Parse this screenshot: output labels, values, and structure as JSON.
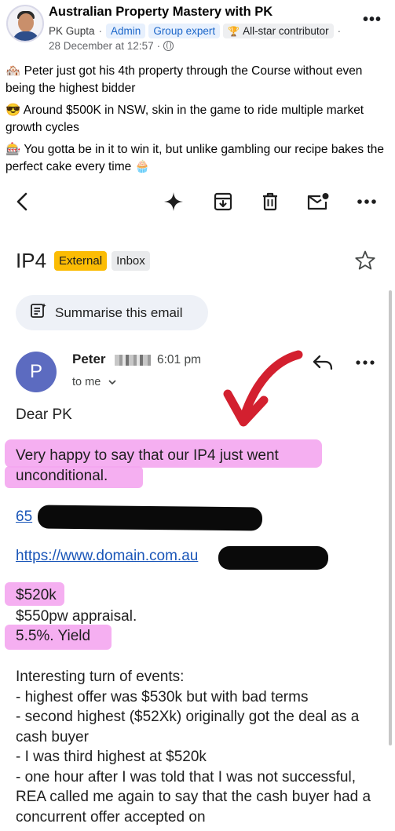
{
  "post": {
    "group_name": "Australian Property Mastery with PK",
    "author": "PK Gupta",
    "badges": [
      "Admin",
      "Group expert",
      "All-star contributor"
    ],
    "date": "28 December at 12:57",
    "lines": [
      {
        "emoji": "🏘️",
        "text": "Peter just got his 4th property through the Course without even being the highest bidder"
      },
      {
        "emoji": "😎",
        "text": "Around $500K in NSW, skin in the game to ride multiple market growth cycles"
      },
      {
        "emoji": "🎰",
        "text": "You gotta be in it to win it, but unlike gambling our recipe bakes the perfect cake every time 🧁"
      }
    ]
  },
  "toolbar": {
    "icons": [
      "back-icon",
      "gemini-sparkle-icon",
      "archive-icon",
      "delete-icon",
      "mark-unread-icon",
      "more-icon"
    ]
  },
  "email": {
    "subject": "IP4",
    "labels": [
      "External",
      "Inbox"
    ],
    "summarise_label": "Summarise this email",
    "sender_initial": "P",
    "sender_name": "Peter",
    "time": "6:01 pm",
    "to": "to me",
    "greeting": "Dear PK",
    "highlight_line_1": "Very happy to say that our IP4 just went",
    "highlight_line_2": "unconditional.",
    "link_1": "65",
    "link_2": "https://www.domain.com.au",
    "figures": [
      "$520k",
      "$550pw appraisal.",
      "5.5%. Yield"
    ],
    "events_title": "Interesting turn of events:",
    "events": [
      "- highest offer was $530k but with bad terms",
      "- second highest ($52Xk) originally got the deal as a cash buyer",
      "- I was third highest at $520k",
      "- one hour after I was told that I was not successful, REA called me again to say that the cash buyer had a concurrent offer accepted on"
    ]
  },
  "colors": {
    "highlight": "#f4a6f0",
    "external_tag": "#fbbc04",
    "link": "#1a56b8",
    "sender_avatar": "#5c6bc0",
    "arrow": "#d3202f"
  }
}
